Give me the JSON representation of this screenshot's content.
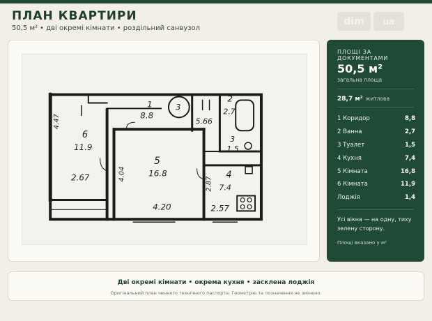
{
  "header": {
    "title": "ПЛАН КВАРТИРИ",
    "subtitle": "50,5 м² • дві окремі кімнати • роздільний санвузол",
    "logo_part1": "dim",
    "logo_part2": "ua"
  },
  "plan": {
    "labels": {
      "room6_num": "6",
      "room6_area": "11.9",
      "room6_dim_side": "4.47",
      "room6_dim_bottom": "2.67",
      "room1_num": "1",
      "room1_area": "8.8",
      "room3_num": "3",
      "room2_num": "2",
      "room2_area": "2.7",
      "room3_area": "1.5",
      "corridor_dim": "5.66",
      "room5_num": "5",
      "room5_area": "16.8",
      "room5_dim_side": "4.04",
      "room5_dim_bottom": "4.20",
      "room4_num": "4",
      "room4_area": "7.4",
      "room4_dim_side": "2.87",
      "room4_dim_bottom": "2.57"
    }
  },
  "summary": {
    "header": "ПЛОЩІ ЗА ДОКУМЕНТАМИ",
    "total": "50,5 м²",
    "total_label": "загальна площа",
    "living_value": "28,7 м²",
    "living_label": "житлова",
    "rooms": [
      {
        "name": "1 Коридор",
        "value": "8,8"
      },
      {
        "name": "2 Ванна",
        "value": "2,7"
      },
      {
        "name": "3 Туалет",
        "value": "1,5"
      },
      {
        "name": "4 Кухня",
        "value": "7,4"
      },
      {
        "name": "5 Кімната",
        "value": "16,8"
      },
      {
        "name": "6 Кімната",
        "value": "11,9"
      },
      {
        "name": "Лоджія",
        "value": "1,4"
      }
    ],
    "note": "Усі вікна — на одну, тиху зелену сторону.",
    "footnote": "Площі вказано у м²"
  },
  "footer": {
    "highlights": "Дві окремі кімнати • окрема кухня • засклена лоджія",
    "disclaimer": "Оригінальний план чинного технічного паспорта. Геометрію та позначення не змінено."
  }
}
